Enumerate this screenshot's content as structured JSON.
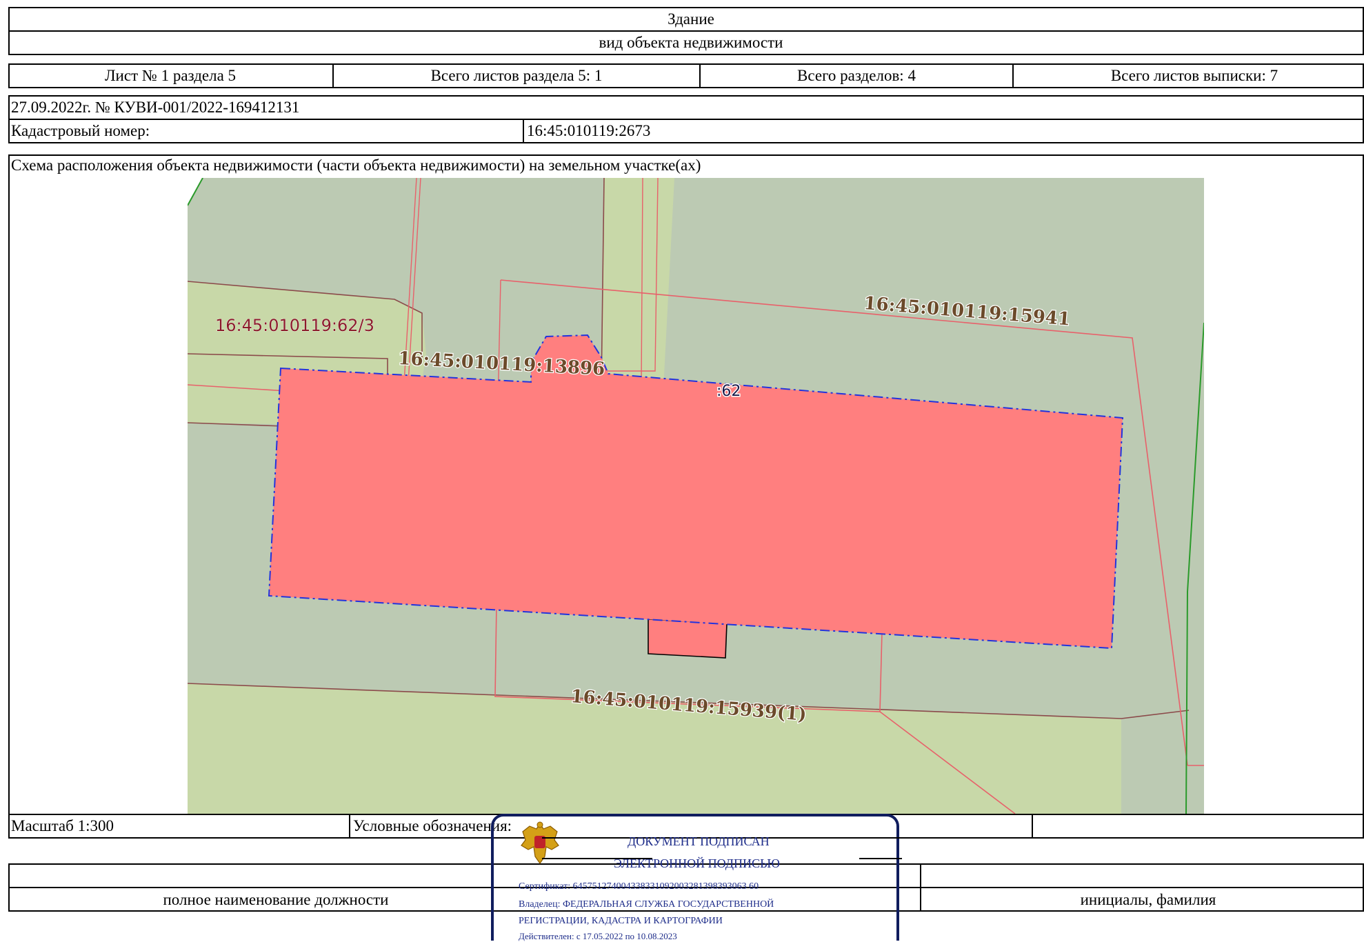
{
  "header": {
    "object_type": "Здание",
    "object_type_caption": "вид объекта недвижимости"
  },
  "sheet_info": {
    "sheet": "Лист № 1 раздела 5",
    "sheets_in_section": "Всего листов раздела 5: 1",
    "sections_total": "Всего разделов: 4",
    "sheets_total": "Всего листов выписки: 7"
  },
  "document": {
    "date_number": "27.09.2022г. № КУВИ-001/2022-169412131",
    "cadastral_label": "Кадастровый номер:",
    "cadastral_value": "16:45:010119:2673"
  },
  "scheme": {
    "title": "Схема расположения объекта недвижимости (части объекта недвижимости) на земельном участке(ах)",
    "labels": {
      "parcel_62_3": "16:45:010119:62/3",
      "parcel_13896": "16:45:010119:13896",
      "parcel_15941": "16:45:010119:15941",
      "parcel_15939": "16:45:010119:15939(1)",
      "parcel_62": ":62"
    },
    "colors": {
      "background_gray": "#bccab3",
      "strip_green": "#c8d8a8",
      "building_fill": "#ff7f7f",
      "boundary_red": "#e8606a",
      "boundary_brown": "#8b4a4a",
      "building_outline": "#2233dd",
      "label_brown": "#6b4a2a",
      "label_dark_red": "#8b1a2a",
      "edge_green": "#2a9a2a"
    }
  },
  "footer": {
    "scale": "Масштаб 1:300",
    "legend": "Условные обозначения:",
    "position_caption": "полное наименование должности",
    "name_caption": "инициалы, фамилия"
  },
  "stamp": {
    "line1": "ДОКУМЕНТ ПОДПИСАН",
    "line2": "ЭЛЕКТРОННОЙ ПОДПИСЬЮ",
    "certificate": "Сертификат: 645751274004338331092003281398393063 60",
    "owner_line1": "Владелец: ФЕДЕРАЛЬНАЯ СЛУЖБА ГОСУДАРСТВЕННОЙ",
    "owner_line2": "РЕГИСТРАЦИИ, КАДАСТРА И КАРТОГРАФИИ",
    "valid": "Действителен: с 17.05.2022 по 10.08.2023",
    "emblem": "double-headed-eagle-emblem"
  }
}
